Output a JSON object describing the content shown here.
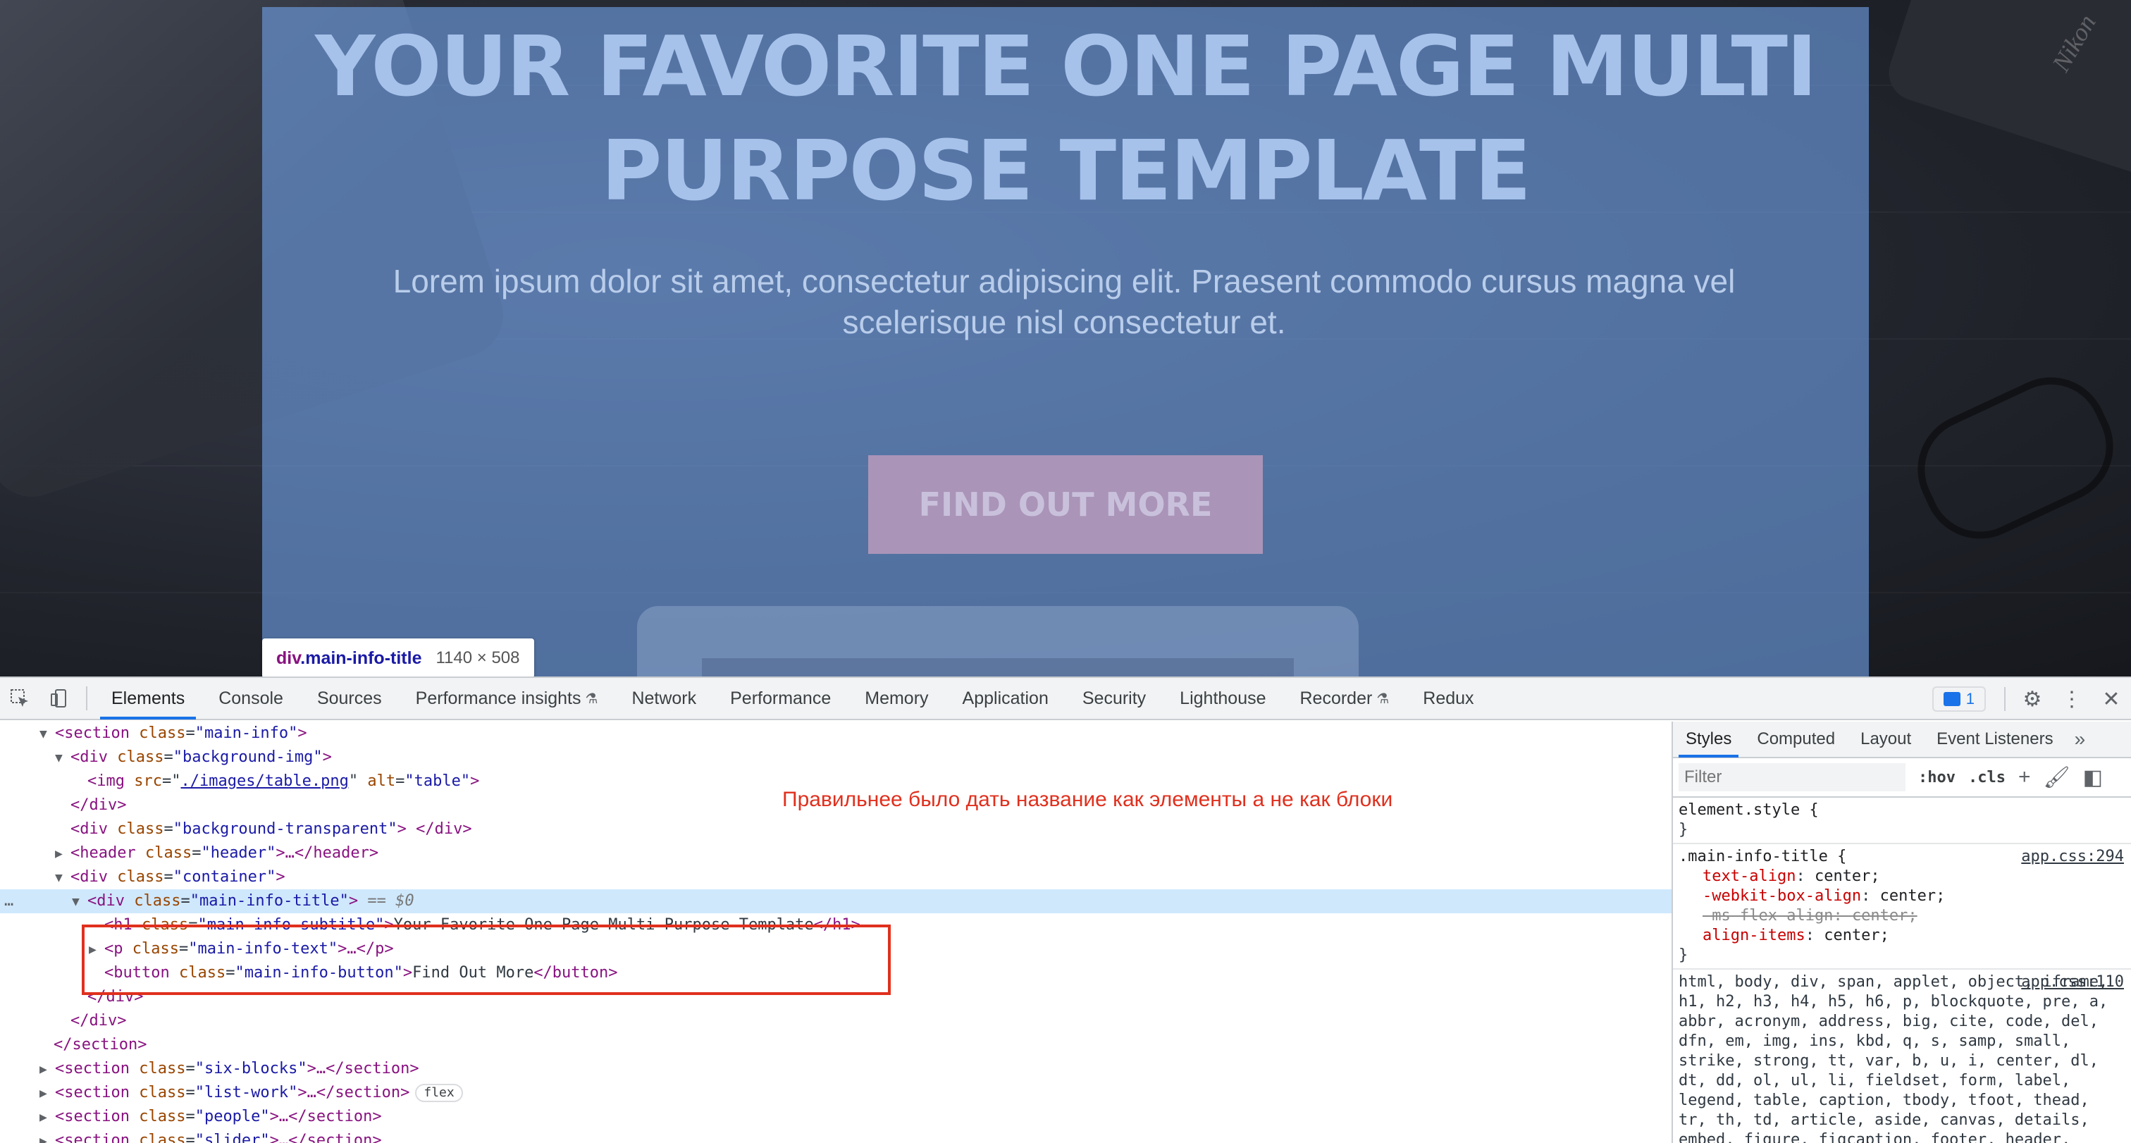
{
  "page": {
    "hero_title": "YOUR FAVORITE ONE PAGE MULTI PURPOSE TEMPLATE",
    "hero_text": "Lorem ipsum dolor sit amet, consectetur adipiscing elit. Praesent commodo cursus magna vel scelerisque nisl consectetur et.",
    "hero_button": "FIND OUT MORE",
    "camera_brand": "Nikon",
    "highlight_color": "#6fa0e6"
  },
  "inspect_tooltip": {
    "tag": "div",
    "class": ".main-info-title",
    "size": "1140 × 508"
  },
  "devtools": {
    "tabs": [
      "Elements",
      "Console",
      "Sources",
      "Performance insights",
      "Network",
      "Performance",
      "Memory",
      "Application",
      "Security",
      "Lighthouse",
      "Recorder",
      "Redux"
    ],
    "active_tab": "Elements",
    "issues_count": "1",
    "annotation": "Правильнее было дать название как элементы а не как блоки",
    "dom": {
      "l1": {
        "tag_open": "<section",
        "attr": "class",
        "val": "\"main-info\"",
        "tag_close": ">"
      },
      "l2": {
        "tag_open": "<div",
        "attr": "class",
        "val": "\"background-img\"",
        "tag_close": ">"
      },
      "l3": {
        "tag_open": "<img",
        "attr1": "src",
        "val1": "./images/table.png",
        "attr2": "alt",
        "val2": "\"table\"",
        "tag_close": ">"
      },
      "l4": {
        "tag": "</div>"
      },
      "l5": {
        "tag_open": "<div",
        "attr": "class",
        "val": "\"background-transparent\"",
        "tag_close": "> </div>"
      },
      "l6": {
        "tag_open": "<header",
        "attr": "class",
        "val": "\"header\"",
        "tag_close": ">…</header>"
      },
      "l7": {
        "tag_open": "<div",
        "attr": "class",
        "val": "\"container\"",
        "tag_close": ">"
      },
      "l8": {
        "tag_open": "<div",
        "attr": "class",
        "val": "\"main-info-title\"",
        "tag_close": ">",
        "marker": "== $0"
      },
      "l9": {
        "tag_open": "<h1",
        "attr": "class",
        "val": "\"main-info-subtitle\"",
        "tag_close": ">",
        "text": "Your Favorite One Page Multi Purpose Template",
        "end": "</h1>"
      },
      "l10": {
        "tag_open": "<p",
        "attr": "class",
        "val": "\"main-info-text\"",
        "tag_close": ">…</p>"
      },
      "l11": {
        "tag_open": "<button",
        "attr": "class",
        "val": "\"main-info-button\"",
        "tag_close": ">",
        "text": "Find Out More",
        "end": "</button>"
      },
      "l12": {
        "tag": "</div>"
      },
      "l13": {
        "tag": "</div>"
      },
      "l14": {
        "tag": "</section>"
      },
      "l15": {
        "tag_open": "<section",
        "attr": "class",
        "val": "\"six-blocks\"",
        "tag_close": ">…</section>"
      },
      "l16": {
        "tag_open": "<section",
        "attr": "class",
        "val": "\"list-work\"",
        "tag_close": ">…</section>",
        "badge": "flex"
      },
      "l17": {
        "tag_open": "<section",
        "attr": "class",
        "val": "\"people\"",
        "tag_close": ">…</section>"
      },
      "l18": {
        "tag_open": "<section",
        "attr": "class",
        "val": "\"slider\"",
        "tag_close": ">…</section>"
      }
    },
    "styles": {
      "tabs": [
        "Styles",
        "Computed",
        "Layout",
        "Event Listeners"
      ],
      "filter_placeholder": "Filter",
      "hov": ":hov",
      "cls": ".cls",
      "element_style": "element.style {",
      "close_brace": "}",
      "rule1": {
        "selector": ".main-info-title {",
        "source": "app.css:294",
        "decls": [
          {
            "prop": "text-align",
            "val": "center;"
          },
          {
            "prop": "-webkit-box-align",
            "val": "center;"
          },
          {
            "prop": "-ms-flex-align",
            "val": "center;"
          },
          {
            "prop": "align-items",
            "val": "center;"
          }
        ]
      },
      "rule2": {
        "source": "app.css:110",
        "selector_text": "html, body, div, span, applet, object, iframe, h1, h2, h3, h4, h5, h6, p, blockquote, pre, a, abbr, acronym, address, big, cite, code, del, dfn, em, img, ins, kbd, q, s, samp, small, strike, strong, tt, var, b, u, i, center, dl, dt, dd, ol, ul, li, fieldset, form, label, legend, table, caption, tbody, tfoot, thead, tr, th, td, article, aside, canvas, details, embed, figure, figcaption, footer, header, hgroup, menu, nav, output, ruby,"
      }
    }
  }
}
